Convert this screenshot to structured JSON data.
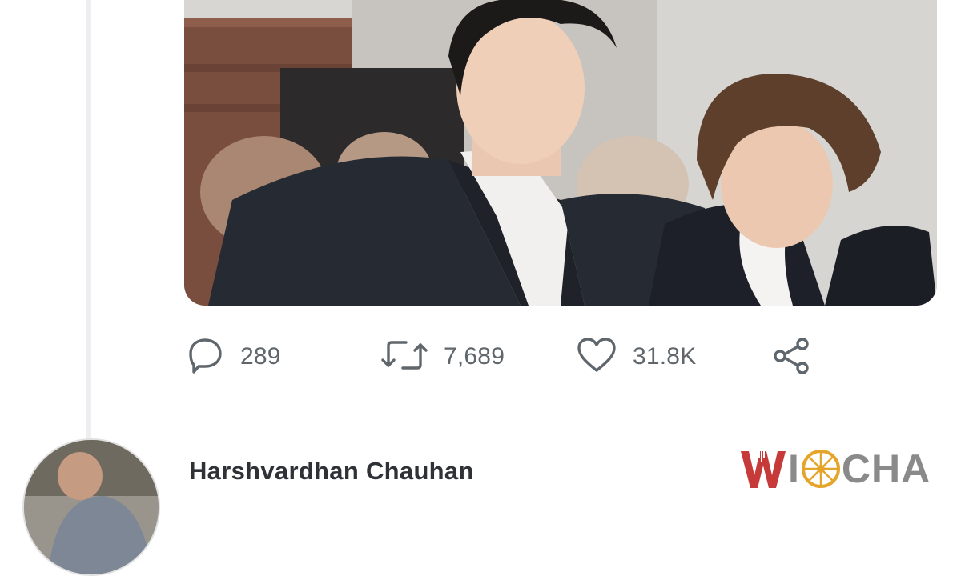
{
  "tweet": {
    "actions": {
      "replies": "289",
      "retweets": "7,689",
      "likes": "31.8K"
    }
  },
  "reply": {
    "author_name": "Harshvardhan Chauhan"
  },
  "watermark": {
    "text": "WIOCHA",
    "accent_color": "#c73a3a",
    "wheel_color": "#e4a52a"
  },
  "colors": {
    "icon_gray": "#5f666c",
    "text_dark": "#2e3236"
  }
}
